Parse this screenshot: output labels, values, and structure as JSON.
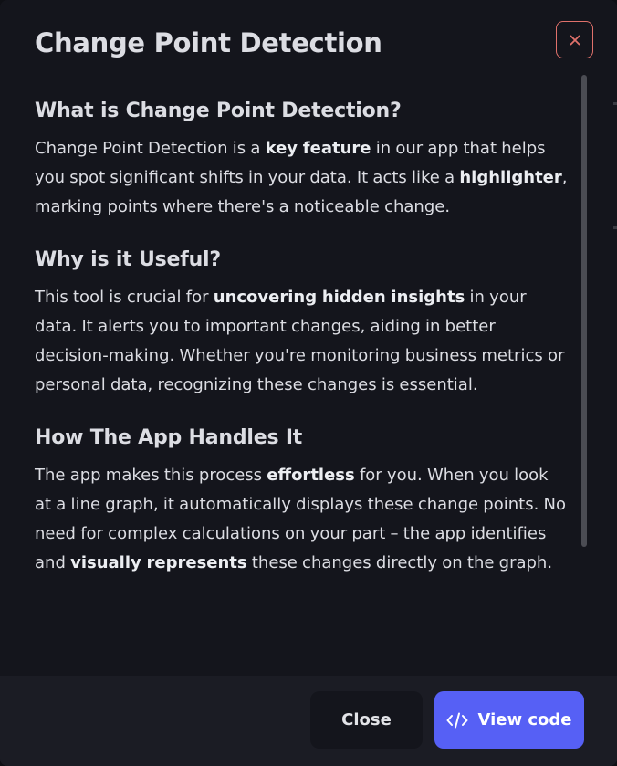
{
  "modal": {
    "title": "Change Point Detection",
    "close_icon": "close-x-icon",
    "accent_close_color": "#e0716b"
  },
  "sections": [
    {
      "heading": "What is Change Point Detection?",
      "paragraph": [
        {
          "text": "Change Point Detection is a ",
          "bold": false
        },
        {
          "text": "key feature",
          "bold": true
        },
        {
          "text": " in our app that helps you spot significant shifts in your data. It acts like a ",
          "bold": false
        },
        {
          "text": "highlighter",
          "bold": true
        },
        {
          "text": ", marking points where there's a noticeable change.",
          "bold": false
        }
      ]
    },
    {
      "heading": "Why is it Useful?",
      "paragraph": [
        {
          "text": "This tool is crucial for ",
          "bold": false
        },
        {
          "text": "uncovering hidden insights",
          "bold": true
        },
        {
          "text": " in your data. It alerts you to important changes, aiding in better decision-making. Whether you're monitoring business metrics or personal data, recognizing these changes is essential.",
          "bold": false
        }
      ]
    },
    {
      "heading": "How The App Handles It",
      "paragraph": [
        {
          "text": "The app makes this process ",
          "bold": false
        },
        {
          "text": "effortless",
          "bold": true
        },
        {
          "text": " for you. When you look at a line graph, it automatically displays these change points. No need for complex calculations on your part – the app identifies and ",
          "bold": false
        },
        {
          "text": "visually represents",
          "bold": true
        },
        {
          "text": " these changes directly on the graph.",
          "bold": false
        }
      ]
    }
  ],
  "footer": {
    "close_label": "Close",
    "view_code_label": "View code",
    "view_code_icon": "code-icon",
    "primary_color": "#5660f5"
  }
}
